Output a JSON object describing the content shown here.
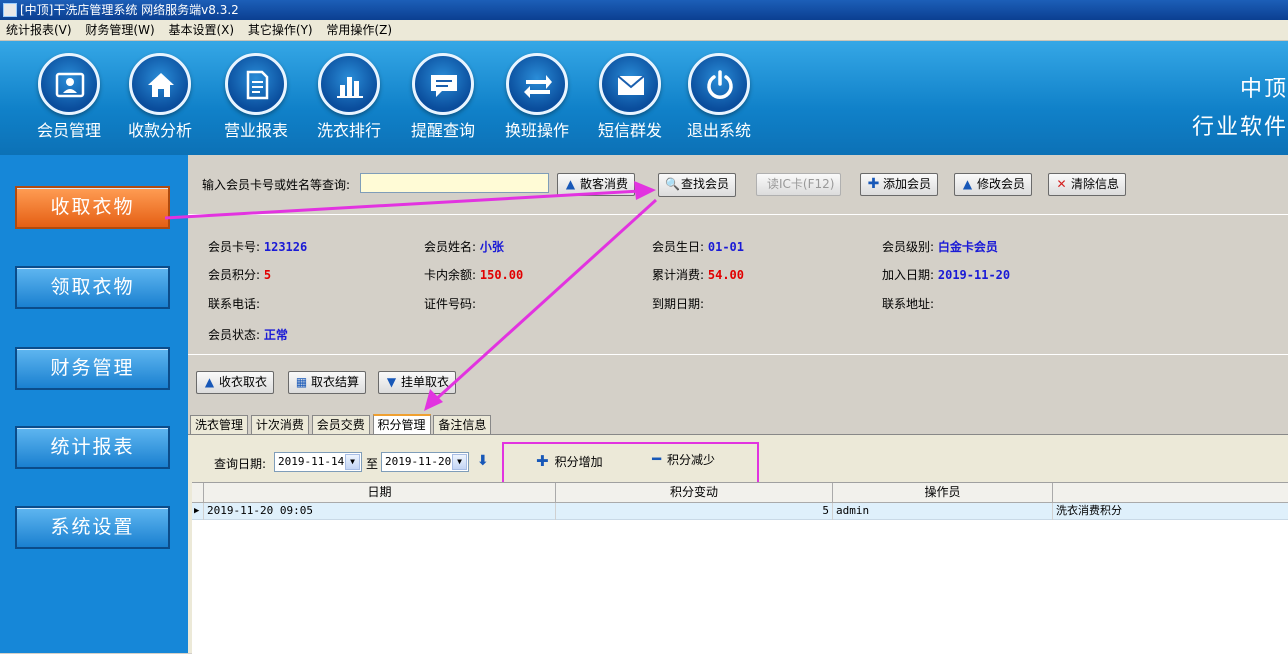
{
  "window": {
    "title": "[中顶]干洗店管理系统 网络服务端v8.3.2"
  },
  "menu": [
    "统计报表(V)",
    "财务管理(W)",
    "基本设置(X)",
    "其它操作(Y)",
    "常用操作(Z)"
  ],
  "toolbar": {
    "items": [
      {
        "label": "会员管理",
        "icon": "member-card-icon"
      },
      {
        "label": "收款分析",
        "icon": "home-icon"
      },
      {
        "label": "营业报表",
        "icon": "document-icon"
      },
      {
        "label": "洗衣排行",
        "icon": "bar-chart-icon"
      },
      {
        "label": "提醒查询",
        "icon": "message-icon"
      },
      {
        "label": "换班操作",
        "icon": "swap-arrows-icon"
      },
      {
        "label": "短信群发",
        "icon": "mail-icon"
      },
      {
        "label": "退出系统",
        "icon": "power-icon"
      }
    ],
    "brand_line1": "中顶",
    "brand_line2": "行业软件"
  },
  "leftnav": [
    "收取衣物",
    "领取衣物",
    "财务管理",
    "统计报表",
    "系统设置"
  ],
  "search": {
    "label": "输入会员卡号或姓名等查询:",
    "value": "",
    "buttons": {
      "walkin": "散客消费",
      "find": "查找会员",
      "readic": "读IC卡(F12)",
      "add": "添加会员",
      "edit": "修改会员",
      "clear": "清除信息"
    }
  },
  "member": {
    "card_no_label": "会员卡号:",
    "card_no": "123126",
    "name_label": "会员姓名:",
    "name": "小张",
    "birthday_label": "会员生日:",
    "birthday": "01-01",
    "level_label": "会员级别:",
    "level": "白金卡会员",
    "points_label": "会员积分:",
    "points": "5",
    "balance_label": "卡内余额:",
    "balance": "150.00",
    "total_label": "累计消费:",
    "total": "54.00",
    "join_label": "加入日期:",
    "join": "2019-11-20",
    "phone_label": "联系电话:",
    "id_label": "证件号码:",
    "expire_label": "到期日期:",
    "address_label": "联系地址:",
    "status_label": "会员状态:",
    "status": "正常"
  },
  "actions": {
    "receive": "收衣取衣",
    "checkout": "取衣结算",
    "hold": "挂单取衣"
  },
  "tabs": [
    "洗衣管理",
    "计次消费",
    "会员交费",
    "积分管理",
    "备注信息"
  ],
  "points_panel": {
    "date_label": "查询日期:",
    "from": "2019-11-14",
    "to_label": "至",
    "to": "2019-11-20",
    "increase": "积分增加",
    "decrease": "积分减少",
    "columns": [
      "日期",
      "积分变动",
      "操作员",
      ""
    ],
    "rows": [
      {
        "date": "2019-11-20 09:05",
        "change": "5",
        "operator": "admin",
        "note": "洗衣消费积分"
      }
    ]
  },
  "colors": {
    "accent": "#1687d8",
    "active_nav": "#f07a2a",
    "highlight": "#e233e0"
  }
}
